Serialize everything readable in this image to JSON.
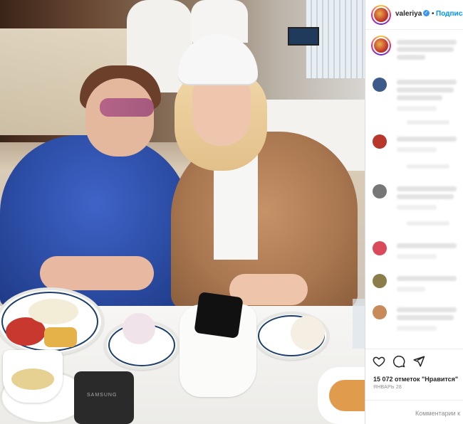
{
  "post": {
    "username": "valeriya",
    "follow_separator": "•",
    "follow_label": "Подписа",
    "verified_mark": "✓"
  },
  "photo": {
    "phone_brand": "SAMSUNG"
  },
  "comments": [
    {
      "avatar_color": "#c44a3a"
    },
    {
      "avatar_color": "#3c5a8a"
    },
    {
      "avatar_color": "#b8362a"
    },
    {
      "avatar_color": "#777777"
    },
    {
      "avatar_color": "#d94a5a"
    },
    {
      "avatar_color": "#8b7d4a"
    },
    {
      "avatar_color": "#c98a5a"
    }
  ],
  "actions": {
    "like_icon": "heart-icon",
    "comment_icon": "comment-icon",
    "share_icon": "paper-plane-icon"
  },
  "likes_text": "15 072 отметок \"Нравится\"",
  "date_text": "ЯНВАРЬ 28",
  "comment_placeholder": "Комментарии к",
  "colors": {
    "link_blue": "#0095f6",
    "verified_blue": "#3897f0",
    "text": "#262626",
    "muted": "#8e8e8e"
  }
}
